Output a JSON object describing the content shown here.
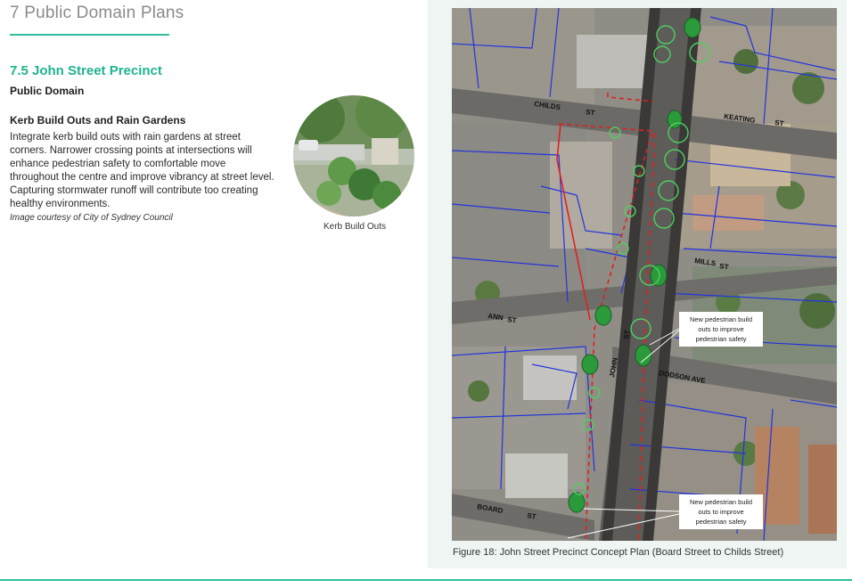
{
  "header": {
    "chapter_title": "7 Public Domain Plans"
  },
  "section": {
    "heading": "7.5 John Street Precinct",
    "subheading": "Public Domain"
  },
  "item": {
    "heading": "Kerb Build Outs and Rain Gardens",
    "body": "Integrate kerb build outs with rain gardens at street corners. Narrower crossing points at intersections will enhance pedestrian safety to comfortable move throughout the centre and improve vibrancy at street level. Capturing stormwater runoff will contribute too creating healthy environments.",
    "credit": "Image courtesy of City of Sydney Council"
  },
  "photo": {
    "caption": "Kerb Build Outs"
  },
  "map": {
    "street_labels": {
      "childs": "CHILDS",
      "childs_st": "ST",
      "keating": "KEATING",
      "keating_st": "ST",
      "mills": "MILLS",
      "mills_st": "ST",
      "ann": "ANN",
      "ann_st": "ST",
      "john": "JOHN",
      "john_st": "ST",
      "dodson": "DODSON AVE",
      "board": "BOARD",
      "board_st": "ST"
    },
    "callouts": [
      "New pedestrian build outs to improve pedestrian safety",
      "New pedestrian build outs to improve pedestrian safety"
    ],
    "colors": {
      "boundary": "#2233dd",
      "precinct": "#e02020",
      "green": "#2a9a3a"
    }
  },
  "figure": {
    "caption": "Figure 18: John Street Precinct Concept Plan (Board Street to Childs Street)"
  }
}
